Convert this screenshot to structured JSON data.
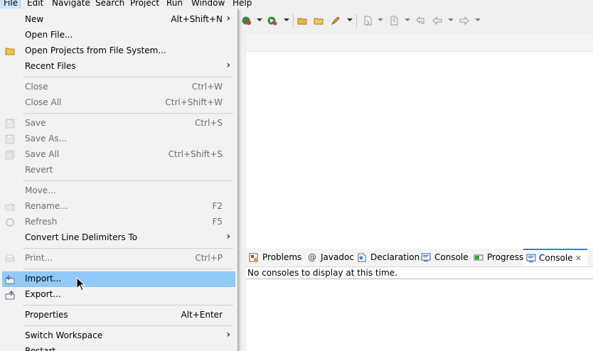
{
  "menubar": {
    "items": [
      "File",
      "Edit",
      "Navigate",
      "Search",
      "Project",
      "Run",
      "Window",
      "Help"
    ],
    "active": "File"
  },
  "file_menu": {
    "items": [
      {
        "label": "New",
        "shortcut": "Alt+Shift+N",
        "submenu": true,
        "enabled": true
      },
      {
        "label": "Open File...",
        "shortcut": "",
        "submenu": false,
        "enabled": true
      },
      {
        "label": "Open Projects from File System...",
        "shortcut": "",
        "submenu": false,
        "enabled": true,
        "icon": "folder-icon"
      },
      {
        "label": "Recent Files",
        "shortcut": "",
        "submenu": true,
        "enabled": true
      },
      {
        "label": "Close",
        "shortcut": "Ctrl+W",
        "submenu": false,
        "enabled": false
      },
      {
        "label": "Close All",
        "shortcut": "Ctrl+Shift+W",
        "submenu": false,
        "enabled": false
      },
      {
        "label": "Save",
        "shortcut": "Ctrl+S",
        "submenu": false,
        "enabled": false,
        "icon": "save-icon"
      },
      {
        "label": "Save As...",
        "shortcut": "",
        "submenu": false,
        "enabled": false,
        "icon": "save-as-icon"
      },
      {
        "label": "Save All",
        "shortcut": "Ctrl+Shift+S",
        "submenu": false,
        "enabled": false,
        "icon": "save-all-icon"
      },
      {
        "label": "Revert",
        "shortcut": "",
        "submenu": false,
        "enabled": false
      },
      {
        "label": "Move...",
        "shortcut": "",
        "submenu": false,
        "enabled": false
      },
      {
        "label": "Rename...",
        "shortcut": "F2",
        "submenu": false,
        "enabled": false,
        "icon": "rename-icon"
      },
      {
        "label": "Refresh",
        "shortcut": "F5",
        "submenu": false,
        "enabled": false,
        "icon": "refresh-icon"
      },
      {
        "label": "Convert Line Delimiters To",
        "shortcut": "",
        "submenu": true,
        "enabled": true
      },
      {
        "label": "Print...",
        "shortcut": "Ctrl+P",
        "submenu": false,
        "enabled": false,
        "icon": "print-icon"
      },
      {
        "label": "Import...",
        "shortcut": "",
        "submenu": false,
        "enabled": true,
        "icon": "import-icon",
        "highlighted": true
      },
      {
        "label": "Export...",
        "shortcut": "",
        "submenu": false,
        "enabled": true,
        "icon": "export-icon"
      },
      {
        "label": "Properties",
        "shortcut": "Alt+Enter",
        "submenu": false,
        "enabled": true
      },
      {
        "label": "Switch Workspace",
        "shortcut": "",
        "submenu": true,
        "enabled": true
      },
      {
        "label": "Restart",
        "shortcut": "",
        "submenu": false,
        "enabled": true
      }
    ]
  },
  "views": {
    "tabs": [
      {
        "label": "Problems",
        "icon": "problems-icon"
      },
      {
        "label": "Javadoc",
        "icon": "javadoc-icon"
      },
      {
        "label": "Declaration",
        "icon": "declaration-icon"
      },
      {
        "label": "Console",
        "icon": "console-icon"
      },
      {
        "label": "Progress",
        "icon": "progress-icon"
      },
      {
        "label": "Console",
        "icon": "console-icon",
        "active": true,
        "closable": true
      }
    ],
    "javadoc_glyph": "@",
    "close_glyph": "✕",
    "message": "No consoles to display at this time."
  },
  "colors": {
    "menu_highlight": "#91c9f7",
    "active_tab_border": "#3a7ccf",
    "disabled_text": "#6d6d6d"
  }
}
